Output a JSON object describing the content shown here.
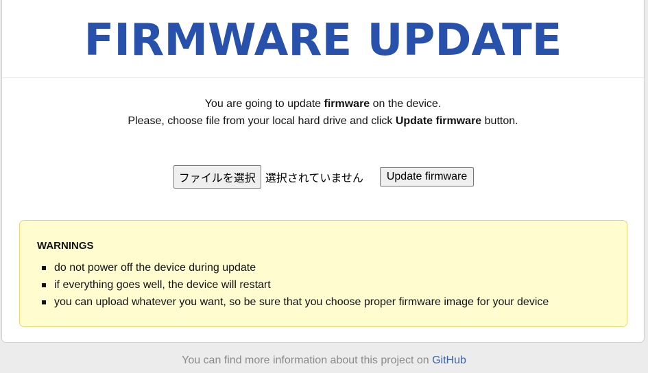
{
  "header": {
    "title": "FIRMWARE UPDATE"
  },
  "intro": {
    "line1_before": "You are going to update ",
    "line1_bold": "firmware",
    "line1_after": " on the device.",
    "line2_before": "Please, choose file from your local hard drive and click ",
    "line2_bold": "Update firmware",
    "line2_after": " button."
  },
  "form": {
    "file_button_label": "ファイルを選択",
    "file_status": "選択されていません",
    "submit_label": "Update firmware"
  },
  "warnings": {
    "title": "WARNINGS",
    "items": [
      "do not power off the device during update",
      "if everything goes well, the device will restart",
      "you can upload whatever you want, so be sure that you choose proper firmware image for your device"
    ]
  },
  "footer": {
    "text": "You can find more information about this project on ",
    "link_label": "GitHub"
  },
  "colors": {
    "title": "#2751ab",
    "warning_bg": "#fffdd0",
    "warning_border": "#f0d370",
    "link": "#3b63b0"
  }
}
